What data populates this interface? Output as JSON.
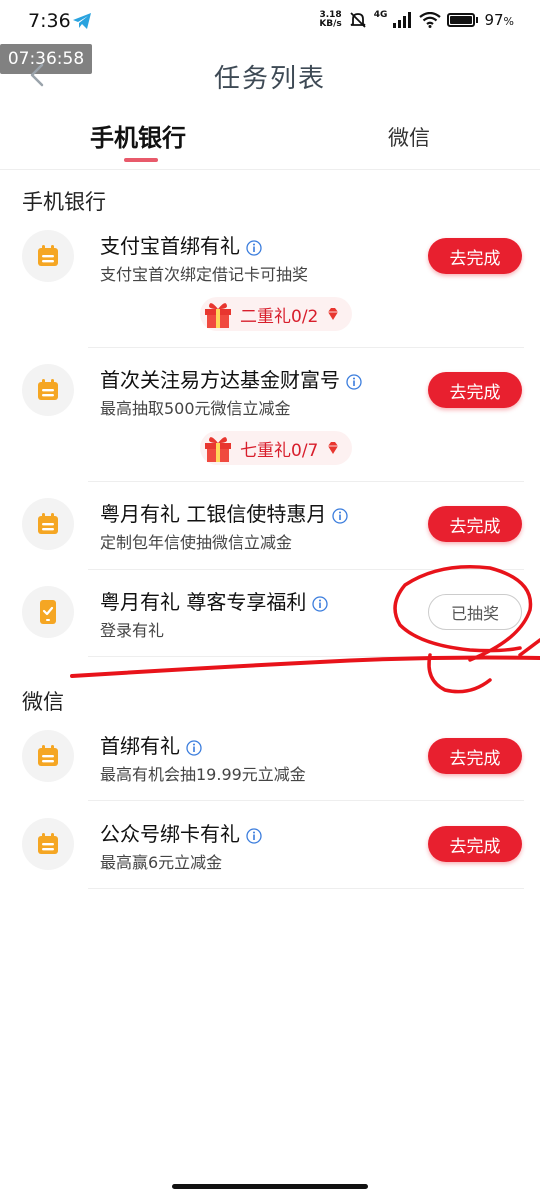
{
  "status_bar": {
    "time": "7:36",
    "speed_value": "3.18",
    "speed_unit": "KB/s",
    "network": "4G",
    "battery": "97",
    "battery_unit": "%"
  },
  "overlay_time": "07:36:58",
  "header": {
    "title": "任务列表"
  },
  "tabs": {
    "active": "手机银行",
    "inactive": "微信"
  },
  "sections": {
    "bank": {
      "title": "手机银行",
      "tasks": [
        {
          "name": "支付宝首绑有礼",
          "desc": "支付宝首次绑定借记卡可抽奖",
          "action": "去完成",
          "gift": "二重礼0/2"
        },
        {
          "name": "首次关注易方达基金财富号",
          "desc": "最高抽取500元微信立减金",
          "action": "去完成",
          "gift": "七重礼0/7"
        },
        {
          "name": "粤月有礼 工银信使特惠月",
          "desc": "定制包年信使抽微信立减金",
          "action": "去完成"
        },
        {
          "name": "粤月有礼 尊客专享福利",
          "desc": "登录有礼",
          "action": "已抽奖"
        }
      ]
    },
    "wechat": {
      "title": "微信",
      "tasks": [
        {
          "name": "首绑有礼",
          "desc": "最高有机会抽19.99元立减金",
          "action": "去完成"
        },
        {
          "name": "公众号绑卡有礼",
          "desc": "最高赢6元立减金",
          "action": "去完成"
        }
      ]
    }
  },
  "colors": {
    "accent": "#e8202f",
    "icon_orange": "#f5a623",
    "tab_indicator": "#e85a6b",
    "info_blue": "#3b7ddd"
  }
}
